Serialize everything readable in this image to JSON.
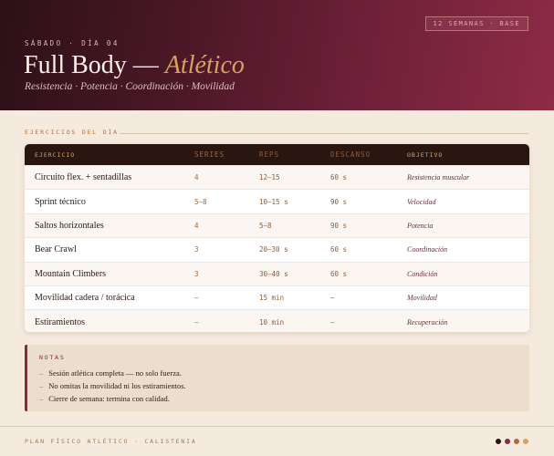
{
  "header": {
    "badge": "12 SEMANAS · BASE",
    "eyebrow": "SÁBADO · DÍA 04",
    "title_main": "Full Body — ",
    "title_accent": "Atlético",
    "subtitle": "Resistencia · Potencia · Coordinación · Movilidad"
  },
  "section": {
    "label": "EJERCICIOS DEL DÍA"
  },
  "table": {
    "headers": [
      "EJERCICIO",
      "SERIES",
      "REPS",
      "DESCANSO",
      "OBJETIVO"
    ],
    "rows": [
      [
        "Circuito flex. + sentadillas",
        "4",
        "12–15",
        "60 s",
        "Resistencia muscular"
      ],
      [
        "Sprint técnico",
        "5–8",
        "10–15 s",
        "90 s",
        "Velocidad"
      ],
      [
        "Saltos horizontales",
        "4",
        "5–8",
        "90 s",
        "Potencia"
      ],
      [
        "Bear Crawl",
        "3",
        "20–30 s",
        "60 s",
        "Coordinación"
      ],
      [
        "Mountain Climbers",
        "3",
        "30–40 s",
        "60 s",
        "Condición"
      ],
      [
        "Movilidad cadera / torácica",
        "–",
        "15 min",
        "–",
        "Movilidad"
      ],
      [
        "Estiramientos",
        "–",
        "10 min",
        "–",
        "Recuperación"
      ]
    ]
  },
  "notes": {
    "title": "NOTAS",
    "items": [
      "Sesión atlética completa — no solo fuerza.",
      "No omitas la movilidad ni los estiramientos.",
      "Cierre de semana: termina con calidad."
    ]
  },
  "footer": {
    "text": "PLAN FÍSICO ATLÉTICO · CALISTENIA",
    "dot_colors": [
      "#2a1610",
      "#8a2a3b",
      "#b06a3c",
      "#d9a05f"
    ]
  }
}
